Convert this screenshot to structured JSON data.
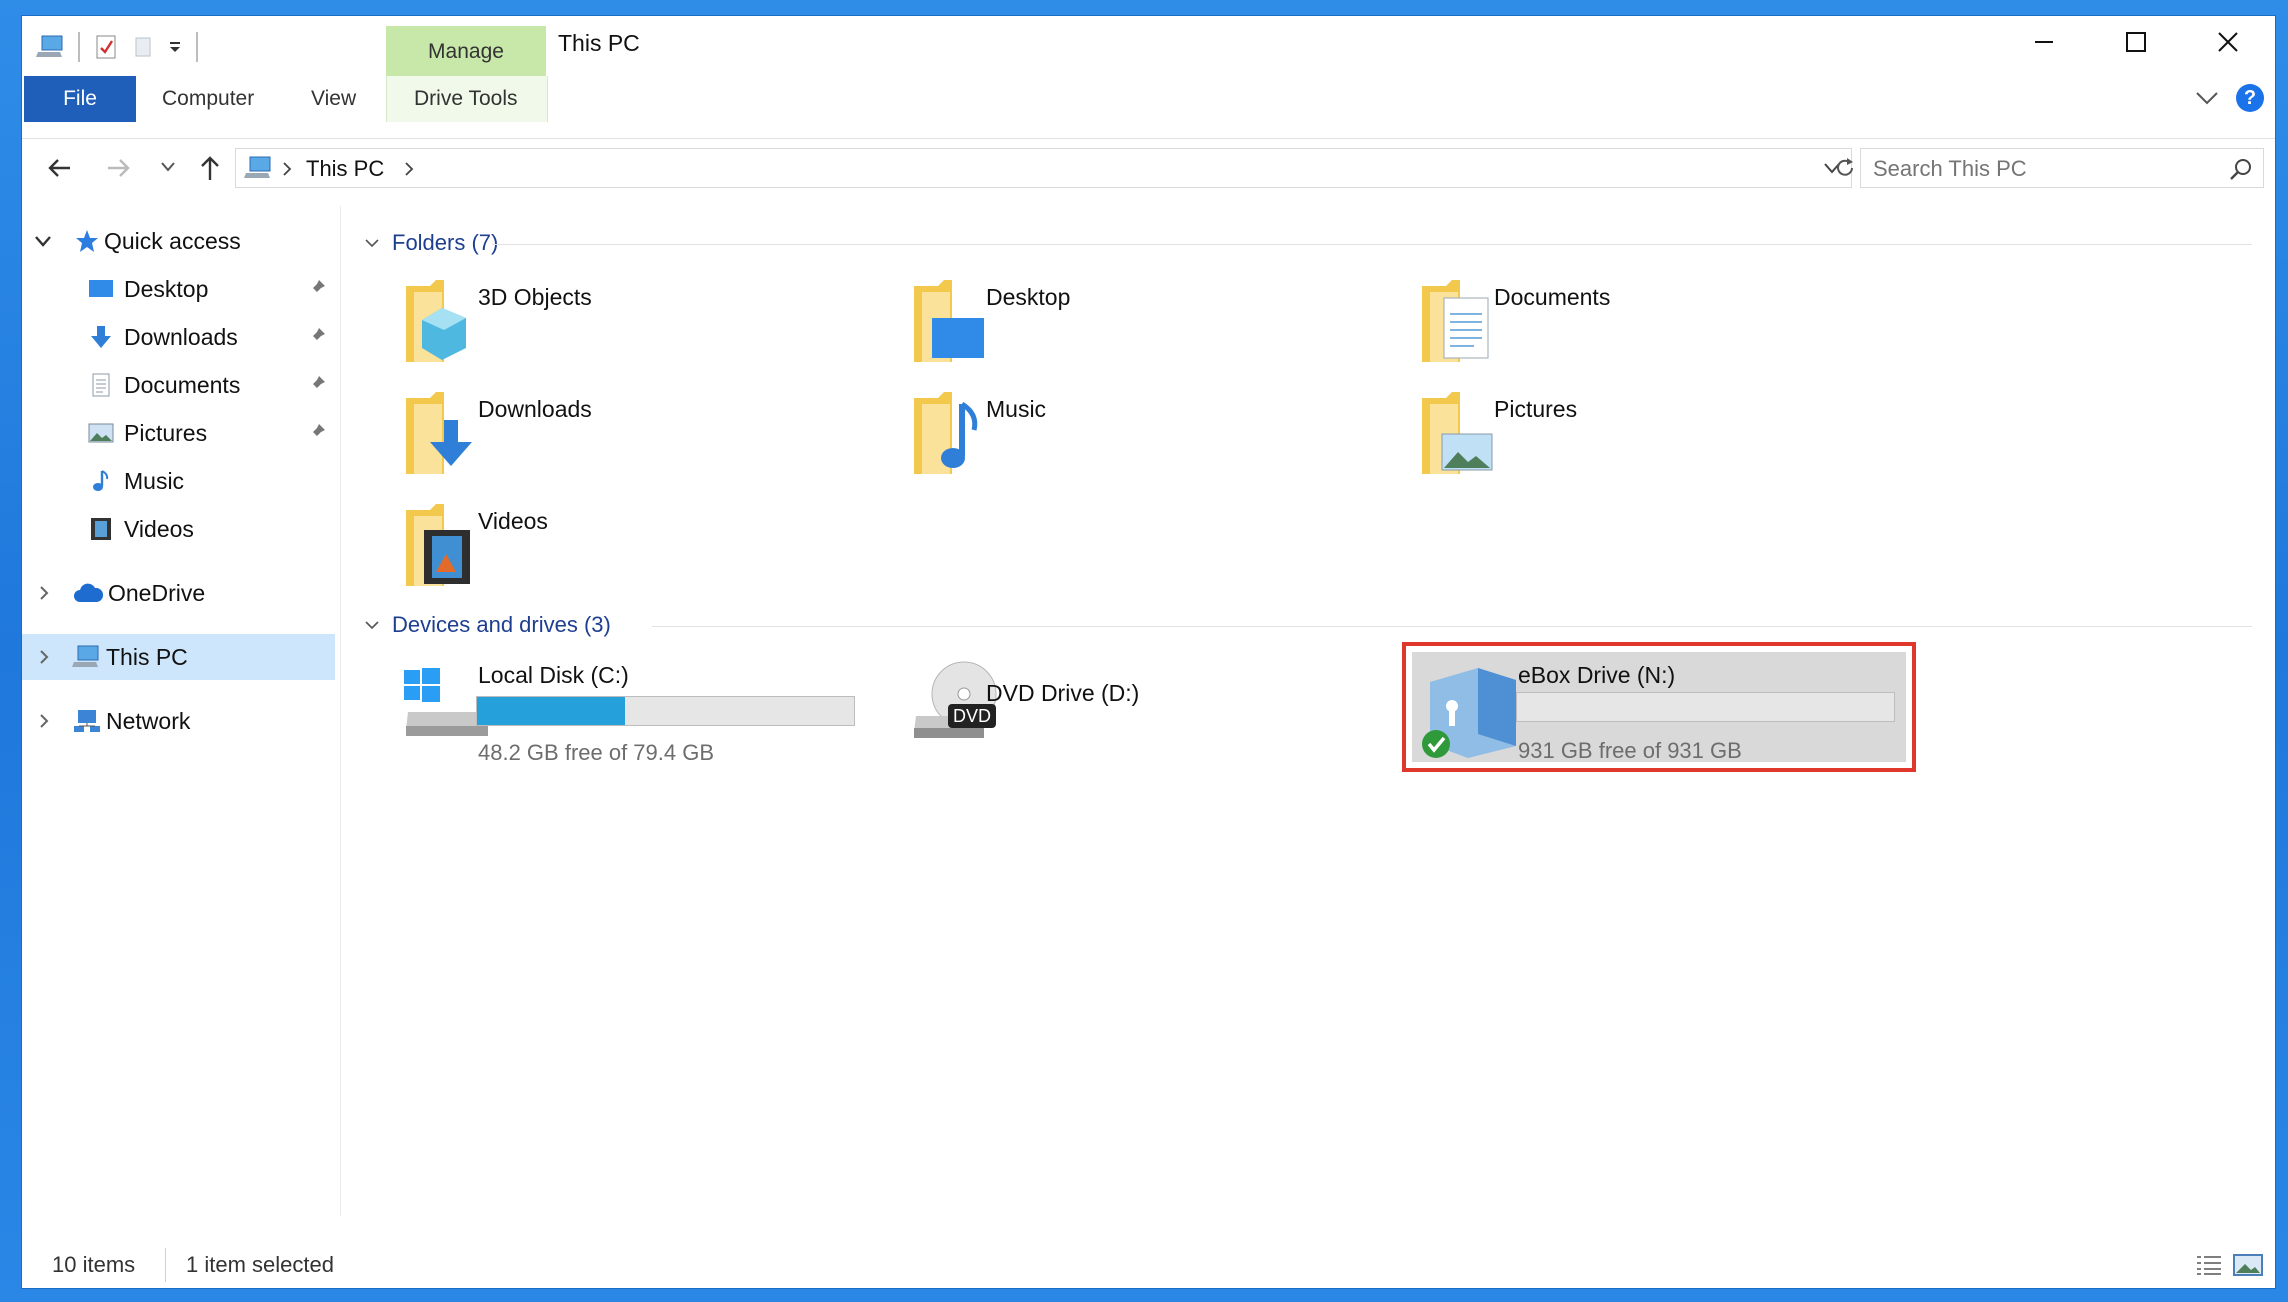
{
  "window": {
    "title": "This PC",
    "context_tab": "Manage",
    "controls": {
      "minimize": "minimize-icon",
      "maximize": "maximize-icon",
      "close": "close-icon"
    }
  },
  "ribbon": {
    "tabs": [
      "File",
      "Computer",
      "View",
      "Drive Tools"
    ],
    "help_label": "?"
  },
  "address": {
    "path": "This PC",
    "search_placeholder": "Search This PC"
  },
  "sidebar": {
    "quick_access": "Quick access",
    "items": [
      {
        "label": "Desktop",
        "pinned": true
      },
      {
        "label": "Downloads",
        "pinned": true
      },
      {
        "label": "Documents",
        "pinned": true
      },
      {
        "label": "Pictures",
        "pinned": true
      },
      {
        "label": "Music",
        "pinned": false
      },
      {
        "label": "Videos",
        "pinned": false
      }
    ],
    "onedrive": "OneDrive",
    "this_pc": "This PC",
    "network": "Network"
  },
  "main": {
    "folders_header": "Folders (7)",
    "folders": [
      "3D Objects",
      "Desktop",
      "Documents",
      "Downloads",
      "Music",
      "Pictures",
      "Videos"
    ],
    "drives_header": "Devices and drives (3)",
    "drives": [
      {
        "name": "Local Disk (C:)",
        "free": "48.2 GB free of 79.4 GB",
        "used_fraction": 0.393
      },
      {
        "name": "DVD Drive (D:)"
      },
      {
        "name": "eBox Drive (N:)",
        "free": "931 GB free of 931 GB",
        "used_fraction": 0.0
      }
    ],
    "dvd_badge": "DVD"
  },
  "status": {
    "items": "10 items",
    "selected": "1 item selected"
  },
  "colors": {
    "accent": "#1f5fb9",
    "manage_tab": "#c7e8a9",
    "selection": "#cde6fb",
    "highlight_border": "#e0372c",
    "drive_bar": "#26a0da"
  }
}
